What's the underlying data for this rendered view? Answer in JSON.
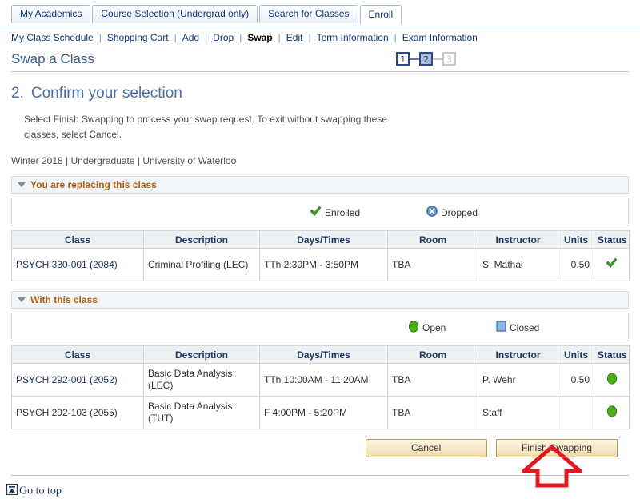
{
  "tabs": [
    {
      "label": "My Academics",
      "accesskey": "M",
      "active": false
    },
    {
      "label": "Course Selection (Undergrad only)",
      "accesskey": "C",
      "active": false
    },
    {
      "label": "Search for Classes",
      "accesskey": "e",
      "active": false
    },
    {
      "label": "Enroll",
      "accesskey": "",
      "active": true
    }
  ],
  "subnav": {
    "items": [
      {
        "label": "My Class Schedule",
        "accesskey": "M",
        "current": false
      },
      {
        "label": "Shopping Cart",
        "accesskey": "",
        "current": false
      },
      {
        "label": "Add",
        "accesskey": "A",
        "current": false
      },
      {
        "label": "Drop",
        "accesskey": "D",
        "current": false
      },
      {
        "label": "Swap",
        "accesskey": "",
        "current": true
      },
      {
        "label": "Edit",
        "accesskey": "t",
        "current": false
      },
      {
        "label": "Term Information",
        "accesskey": "T",
        "current": false
      },
      {
        "label": "Exam Information",
        "accesskey": "",
        "current": false
      }
    ],
    "separator": "|"
  },
  "page": {
    "title": "Swap a Class",
    "steps": [
      {
        "label": "1",
        "state": "normal"
      },
      {
        "label": "2",
        "state": "active"
      },
      {
        "label": "3",
        "state": "disabled"
      }
    ],
    "step_number": "2.",
    "step_heading": "Confirm your selection",
    "instructions": "Select Finish Swapping to process your swap request. To exit without swapping these classes, select Cancel.",
    "term_line": "Winter 2018 | Undergraduate | University of Waterloo"
  },
  "replacing_section": {
    "header": "You are replacing this class",
    "legend": [
      {
        "icon": "green-check-icon",
        "label": "Enrolled",
        "color": "#3f9a26"
      },
      {
        "icon": "blue-x-circle-icon",
        "label": "Dropped",
        "color": "#4a7bbd"
      }
    ],
    "columns": [
      "Class",
      "Description",
      "Days/Times",
      "Room",
      "Instructor",
      "Units",
      "Status"
    ],
    "rows": [
      {
        "class": "PSYCH 330-001 (2084)",
        "class_link": true,
        "description": "Criminal Profiling (LEC)",
        "days_times": "TTh 2:30PM - 3:50PM",
        "room": "TBA",
        "instructor": "S. Mathai",
        "units": "0.50",
        "status_icon": "green-check-icon"
      }
    ]
  },
  "with_section": {
    "header": "With this class",
    "legend": [
      {
        "icon": "green-circle-icon",
        "label": "Open",
        "color": "#4caf18"
      },
      {
        "icon": "blue-square-icon",
        "label": "Closed",
        "color": "#7aa9dd"
      }
    ],
    "columns": [
      "Class",
      "Description",
      "Days/Times",
      "Room",
      "Instructor",
      "Units",
      "Status"
    ],
    "rows": [
      {
        "class": "PSYCH 292-001 (2052)",
        "class_link": true,
        "description": "Basic Data Analysis (LEC)",
        "days_times": "TTh 10:00AM - 11:20AM",
        "room": "TBA",
        "instructor": "P. Wehr",
        "units": "0.50",
        "status_icon": "green-circle-icon"
      },
      {
        "class": "PSYCH 292-103 (2055)",
        "class_link": false,
        "description": "Basic Data Analysis (TUT)",
        "days_times": "F 4:00PM - 5:20PM",
        "room": "TBA",
        "instructor": "Staff",
        "units": "",
        "status_icon": "green-circle-icon"
      }
    ]
  },
  "actions": {
    "cancel_label": "Cancel",
    "finish_label": "Finish Swapping"
  },
  "footer": {
    "go_to_top_label": "Go to top",
    "go_to_top_icon": "go-to-top-icon"
  },
  "annotation": {
    "arrow_icon": "red-up-arrow-annotation",
    "color": "#e01b24"
  }
}
